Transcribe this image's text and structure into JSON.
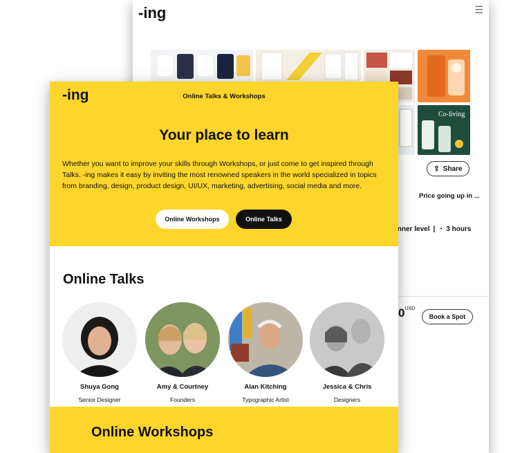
{
  "back_page": {
    "logo": "-ing",
    "menu_icon": "hamburger-icon",
    "thumbnail_caption": "Co-living",
    "share_label": "Share",
    "price_note": "Price going up in ...",
    "level_text": "inner level",
    "duration": "3 hours",
    "price_fragment": "0",
    "price_currency": "USD",
    "book_label": "Book a Spot"
  },
  "front_page": {
    "logo": "-ing",
    "nav_title": "Online Talks & Workshops",
    "hero_title": "Your place to learn",
    "hero_text": "Whether you want to improve your skills through Workshops, or just come to get inspired through Talks. -ing makes it easy by inviting the most renowned speakers in the world specialized in topics from branding, design, product design, UI/UX, marketing, advertising, social media and more.",
    "btn_workshops": "Online Workshops",
    "btn_talks": "Online Talks",
    "talks_title": "Online Talks",
    "speakers": [
      {
        "name": "Shuya Gong",
        "role": "Senior Designer"
      },
      {
        "name": "Amy & Courtney",
        "role": "Founders"
      },
      {
        "name": "Alan Kitching",
        "role": "Typographic Artist"
      },
      {
        "name": "Jessica & Chris",
        "role": "Designers"
      }
    ],
    "workshops_title": "Online Workshops"
  },
  "colors": {
    "accent": "#fed52a",
    "dark": "#111111"
  }
}
